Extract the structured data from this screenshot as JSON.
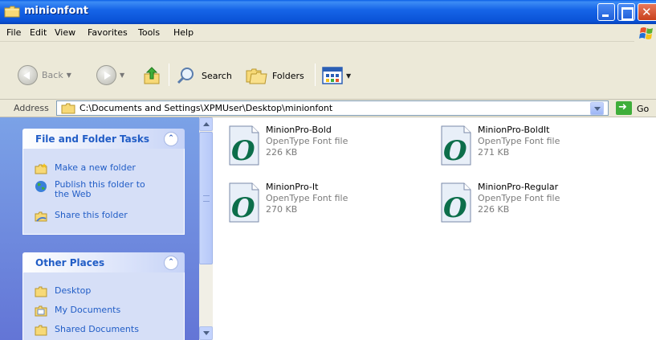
{
  "window": {
    "title": "minionfont"
  },
  "menu": {
    "items": [
      "File",
      "Edit",
      "View",
      "Favorites",
      "Tools",
      "Help"
    ]
  },
  "toolbar": {
    "back_label": "Back",
    "search_label": "Search",
    "folders_label": "Folders"
  },
  "address": {
    "label": "Address",
    "value": "C:\\Documents and Settings\\XPMUser\\Desktop\\minionfont",
    "go_label": "Go"
  },
  "task_pane": {
    "file_folder_tasks": {
      "title": "File and Folder Tasks",
      "items": [
        {
          "label": "Make a new folder",
          "icon": "new-folder-icon"
        },
        {
          "label": "Publish this folder to",
          "label2": "the Web",
          "icon": "globe-icon"
        },
        {
          "label": "Share this folder",
          "icon": "share-folder-icon"
        }
      ]
    },
    "other_places": {
      "title": "Other Places",
      "items": [
        {
          "label": "Desktop",
          "icon": "folder-icon"
        },
        {
          "label": "My Documents",
          "icon": "folder-icon"
        },
        {
          "label": "Shared Documents",
          "icon": "folder-icon"
        }
      ]
    }
  },
  "files": [
    {
      "name": "MinionPro-Bold",
      "type": "OpenType Font file",
      "size": "226 KB",
      "icon": "opentype-font-icon"
    },
    {
      "name": "MinionPro-BoldIt",
      "type": "OpenType Font file",
      "size": "271 KB",
      "icon": "opentype-font-icon"
    },
    {
      "name": "MinionPro-It",
      "type": "OpenType Font file",
      "size": "270 KB",
      "icon": "opentype-font-icon"
    },
    {
      "name": "MinionPro-Regular",
      "type": "OpenType Font file",
      "size": "226 KB",
      "icon": "opentype-font-icon"
    }
  ],
  "colors": {
    "titlebar": "#0a52d6",
    "task_pane_bg": "#7ba2e7",
    "task_link": "#215dc6",
    "chrome": "#ece9d8"
  }
}
